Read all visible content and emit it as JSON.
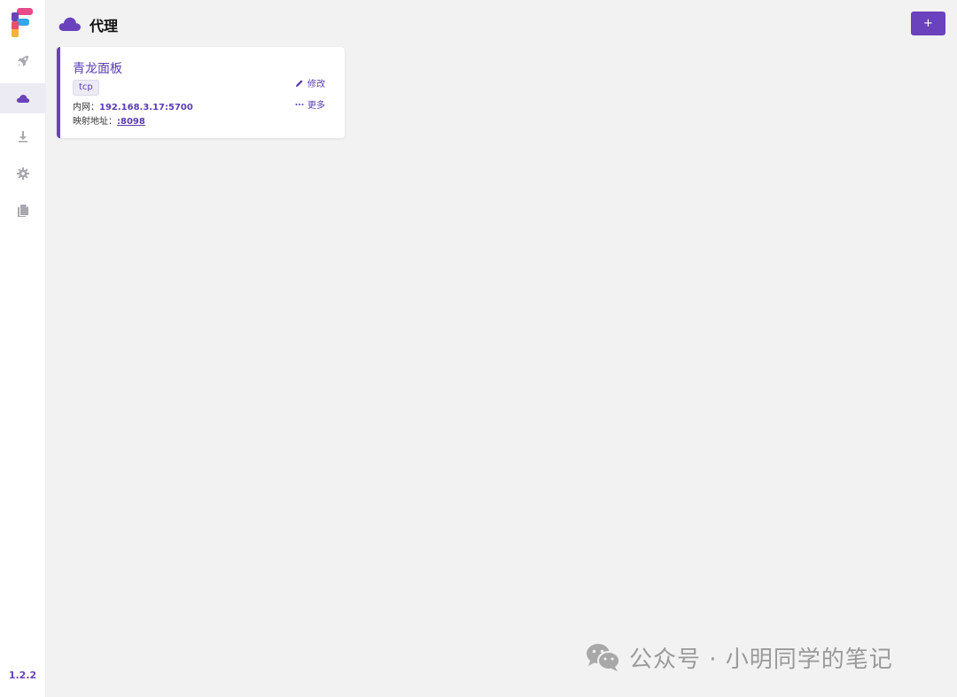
{
  "app": {
    "version": "1.2.2",
    "accent_color": "#6a42bd"
  },
  "sidebar": {
    "items": [
      {
        "icon": "rocket-icon"
      },
      {
        "icon": "cloud-icon",
        "active": true
      },
      {
        "icon": "download-icon"
      },
      {
        "icon": "gear-icon"
      },
      {
        "icon": "documents-icon"
      }
    ]
  },
  "header": {
    "icon": "cloud-icon",
    "title": "代理",
    "add_label": "+"
  },
  "proxies": [
    {
      "name": "青龙面板",
      "type": "tcp",
      "local_label": "内网：",
      "local_value": "192.168.3.17:5700",
      "remote_label": "映射地址：",
      "remote_value": ":8098",
      "edit_label": "修改",
      "more_label": "更多"
    }
  ],
  "watermark": {
    "text": "公众号 · 小明同学的笔记"
  }
}
